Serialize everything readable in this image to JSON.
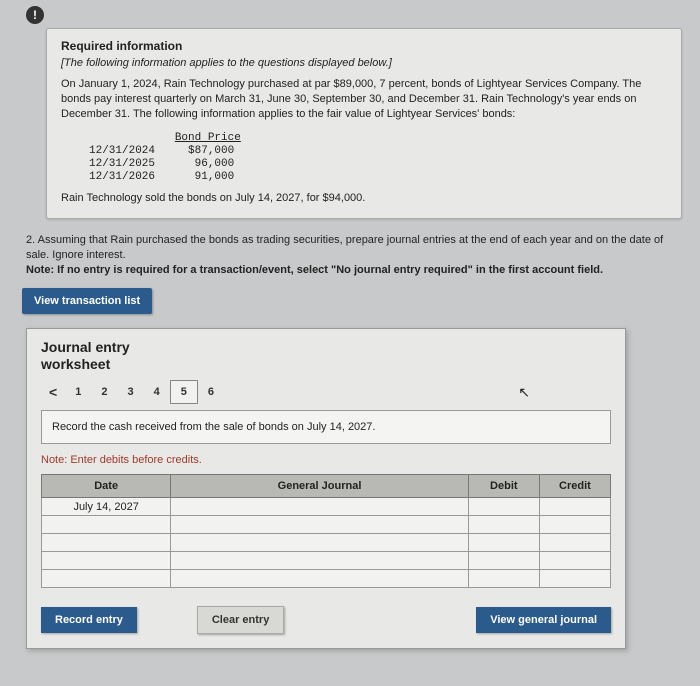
{
  "alert_icon": "!",
  "info": {
    "req_title": "Required information",
    "subtitle": "[The following information applies to the questions displayed below.]",
    "paragraph": "On January 1, 2024, Rain Technology purchased at par $89,000, 7 percent, bonds of Lightyear Services Company. The bonds pay interest quarterly on March 31, June 30, September 30, and December 31. Rain Technology's year ends on December 31. The following information applies to the fair value of Lightyear Services' bonds:",
    "bond_table": {
      "header_date": "",
      "header_price": "Bond Price",
      "rows": [
        {
          "date": "12/31/2024",
          "price": "$87,000"
        },
        {
          "date": "12/31/2025",
          "price": " 96,000"
        },
        {
          "date": "12/31/2026",
          "price": " 91,000"
        }
      ]
    },
    "sold_line": "Rain Technology sold the bonds on July 14, 2027, for $94,000."
  },
  "question": {
    "lead": "2. Assuming that Rain purchased the bonds as trading securities, prepare journal entries at the end of each year and on the date of sale. Ignore interest.",
    "note": "Note: If no entry is required for a transaction/event, select \"No journal entry required\" in the first account field."
  },
  "view_tx_btn": "View transaction list",
  "worksheet": {
    "title1": "Journal entry",
    "title2": "worksheet",
    "chev_left": "<",
    "tabs": [
      "1",
      "2",
      "3",
      "4",
      "5",
      "6"
    ],
    "active_tab_index": 4,
    "chev_right": ">",
    "instruction": "Record the cash received from the sale of bonds on July 14, 2027.",
    "note": "Note: Enter debits before credits.",
    "headers": {
      "date": "Date",
      "gj": "General Journal",
      "debit": "Debit",
      "credit": "Credit"
    },
    "date_value": "July 14, 2027",
    "buttons": {
      "record": "Record entry",
      "clear": "Clear entry",
      "view": "View general journal"
    }
  }
}
